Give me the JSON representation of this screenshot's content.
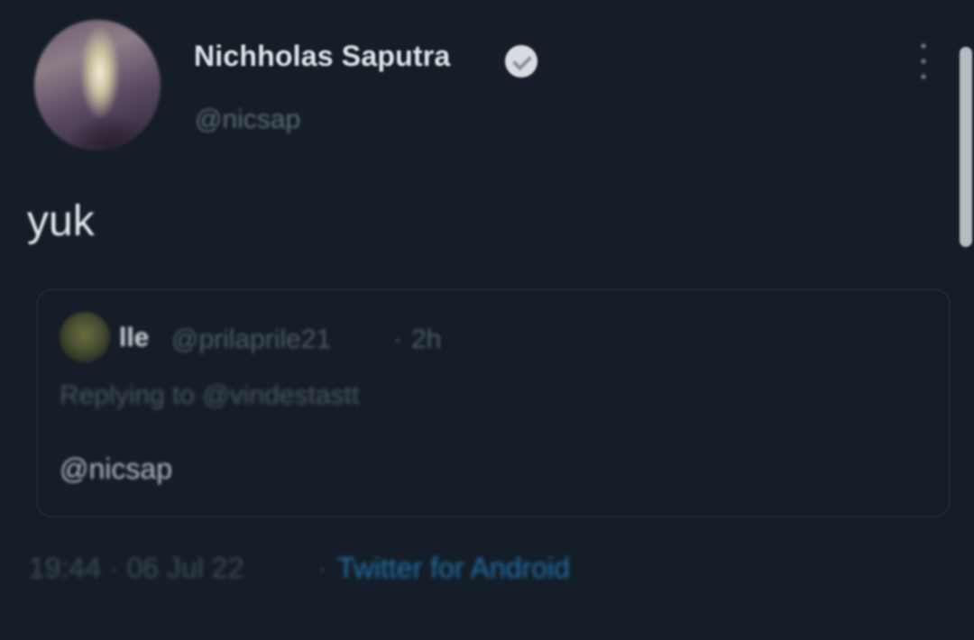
{
  "tweet": {
    "author": {
      "name": "Nichholas Saputra",
      "handle": "@nicsap",
      "verified": true,
      "avatar_icon": "profile-photo"
    },
    "text": "yuk",
    "quoted": {
      "name": "lle",
      "handle": "@prilaprile21",
      "separator": "·",
      "time": "2h",
      "replying_to": "Replying to @vindestastt",
      "body": "@nicsap"
    },
    "meta": {
      "time_date": "19:44 · 06 Jul 22",
      "separator": "·",
      "source": "Twitter for Android"
    }
  },
  "colors": {
    "background": "#151e28",
    "primary_text": "#e6e9ec",
    "secondary_text": "#5f6a76",
    "link": "#1f6fa8"
  }
}
